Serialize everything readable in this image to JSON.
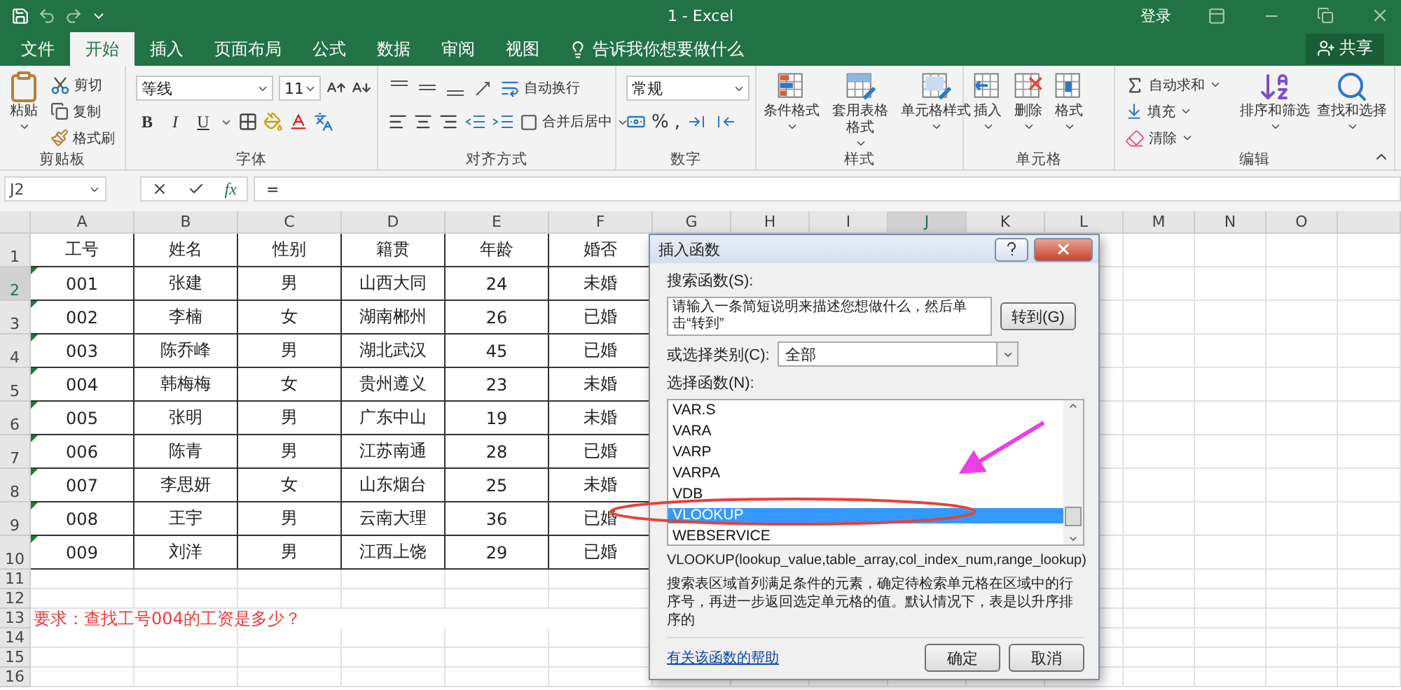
{
  "title_bar": {
    "title": "1 - Excel",
    "sign_in": "登录"
  },
  "tabs": [
    {
      "label": "文件",
      "selected": false
    },
    {
      "label": "开始",
      "selected": true
    },
    {
      "label": "插入",
      "selected": false
    },
    {
      "label": "页面布局",
      "selected": false
    },
    {
      "label": "公式",
      "selected": false
    },
    {
      "label": "数据",
      "selected": false
    },
    {
      "label": "审阅",
      "selected": false
    },
    {
      "label": "视图",
      "selected": false
    }
  ],
  "tell_me": "告诉我你想要做什么",
  "share": "共享",
  "ribbon": [
    {
      "kind": "clipboard",
      "label": "剪贴板",
      "paste": "粘贴",
      "items": [
        "剪切",
        "复制",
        "格式刷"
      ]
    },
    {
      "kind": "font",
      "label": "字体",
      "font": "等线",
      "size": "11",
      "styles": [
        "B",
        "I",
        "U"
      ]
    },
    {
      "kind": "alignment",
      "label": "对齐方式",
      "wrap": "自动换行",
      "merge": "合并后居中"
    },
    {
      "kind": "number",
      "label": "数字",
      "format": "常规",
      "percent": "%",
      "comma": ","
    },
    {
      "kind": "styles",
      "label": "样式",
      "items": [
        "条件格式",
        "套用表格格式",
        "单元格样式"
      ]
    },
    {
      "kind": "cells",
      "label": "单元格",
      "items": [
        "插入",
        "删除",
        "格式"
      ]
    },
    {
      "kind": "editing",
      "label": "编辑",
      "sum": "自动求和",
      "fill": "填充",
      "clear": "清除",
      "sort": "排序和筛选",
      "find": "查找和选择"
    }
  ],
  "formula_bar": {
    "name_box": "J2",
    "function_label": "fx",
    "formula": "="
  },
  "columns": [
    {
      "label": "A",
      "selected": false
    },
    {
      "label": "B",
      "selected": false
    },
    {
      "label": "C",
      "selected": false
    },
    {
      "label": "D",
      "selected": false
    },
    {
      "label": "E",
      "selected": false
    },
    {
      "label": "F",
      "selected": false
    },
    {
      "label": "G",
      "selected": false
    },
    {
      "label": "H",
      "selected": false
    },
    {
      "label": "I",
      "selected": false
    },
    {
      "label": "J",
      "selected": true
    },
    {
      "label": "K",
      "selected": false
    },
    {
      "label": "L",
      "selected": false
    },
    {
      "label": "M",
      "selected": false
    },
    {
      "label": "N",
      "selected": false
    },
    {
      "label": "O",
      "selected": false
    }
  ],
  "rows": [
    {
      "number": "1",
      "selected": false,
      "flagged": false,
      "cells": [
        "工号",
        "姓名",
        "性别",
        "籍贯",
        "年龄",
        "婚否"
      ]
    },
    {
      "number": "2",
      "selected": true,
      "flagged": true,
      "cells": [
        "001",
        "张建",
        "男",
        "山西大同",
        "24",
        "未婚"
      ]
    },
    {
      "number": "3",
      "selected": false,
      "flagged": true,
      "cells": [
        "002",
        "李楠",
        "女",
        "湖南郴州",
        "26",
        "已婚"
      ]
    },
    {
      "number": "4",
      "selected": false,
      "flagged": true,
      "cells": [
        "003",
        "陈乔峰",
        "男",
        "湖北武汉",
        "45",
        "已婚"
      ]
    },
    {
      "number": "5",
      "selected": false,
      "flagged": true,
      "cells": [
        "004",
        "韩梅梅",
        "女",
        "贵州遵义",
        "23",
        "未婚"
      ]
    },
    {
      "number": "6",
      "selected": false,
      "flagged": true,
      "cells": [
        "005",
        "张明",
        "男",
        "广东中山",
        "19",
        "未婚"
      ]
    },
    {
      "number": "7",
      "selected": false,
      "flagged": true,
      "cells": [
        "006",
        "陈青",
        "男",
        "江苏南通",
        "28",
        "已婚"
      ]
    },
    {
      "number": "8",
      "selected": false,
      "flagged": true,
      "cells": [
        "007",
        "李思妍",
        "女",
        "山东烟台",
        "25",
        "未婚"
      ]
    },
    {
      "number": "9",
      "selected": false,
      "flagged": true,
      "cells": [
        "008",
        "王宇",
        "男",
        "云南大理",
        "36",
        "已婚"
      ]
    },
    {
      "number": "10",
      "selected": false,
      "flagged": true,
      "cells": [
        "009",
        "刘洋",
        "男",
        "江西上饶",
        "29",
        "已婚"
      ]
    },
    {
      "number": "11",
      "selected": false,
      "flagged": false
    },
    {
      "number": "12",
      "selected": false,
      "flagged": false
    },
    {
      "number": "13",
      "selected": false,
      "flagged": false,
      "note": "要求：查找工号004的工资是多少？"
    },
    {
      "number": "14",
      "selected": false,
      "flagged": false
    },
    {
      "number": "15",
      "selected": false,
      "flagged": false
    },
    {
      "number": "16",
      "selected": false,
      "flagged": false
    }
  ],
  "dialog": {
    "title": "插入函数",
    "search_label": "搜索函数(S):",
    "search_value": "请输入一条简短说明来描述您想做什么，然后单击“转到”",
    "go_button": "转到(G)",
    "category_label": "或选择类别(C):",
    "category": "全部",
    "function_label": "选择函数(N):",
    "functions": [
      {
        "name": "VAR.S",
        "selected": false
      },
      {
        "name": "VARA",
        "selected": false
      },
      {
        "name": "VARP",
        "selected": false
      },
      {
        "name": "VARPA",
        "selected": false
      },
      {
        "name": "VDB",
        "selected": false
      },
      {
        "name": "VLOOKUP",
        "selected": true
      },
      {
        "name": "WEBSERVICE",
        "selected": false
      }
    ],
    "signature": "VLOOKUP(lookup_value,table_array,col_index_num,range_lookup)",
    "description": "搜索表区域首列满足条件的元素，确定待检索单元格在区域中的行序号，再进一步返回选定单元格的值。默认情况下，表是以升序排序的",
    "help_link": "有关该函数的帮助",
    "ok": "确定",
    "cancel": "取消"
  },
  "annotations": {
    "arrow": true,
    "highlight_ellipse": true
  }
}
